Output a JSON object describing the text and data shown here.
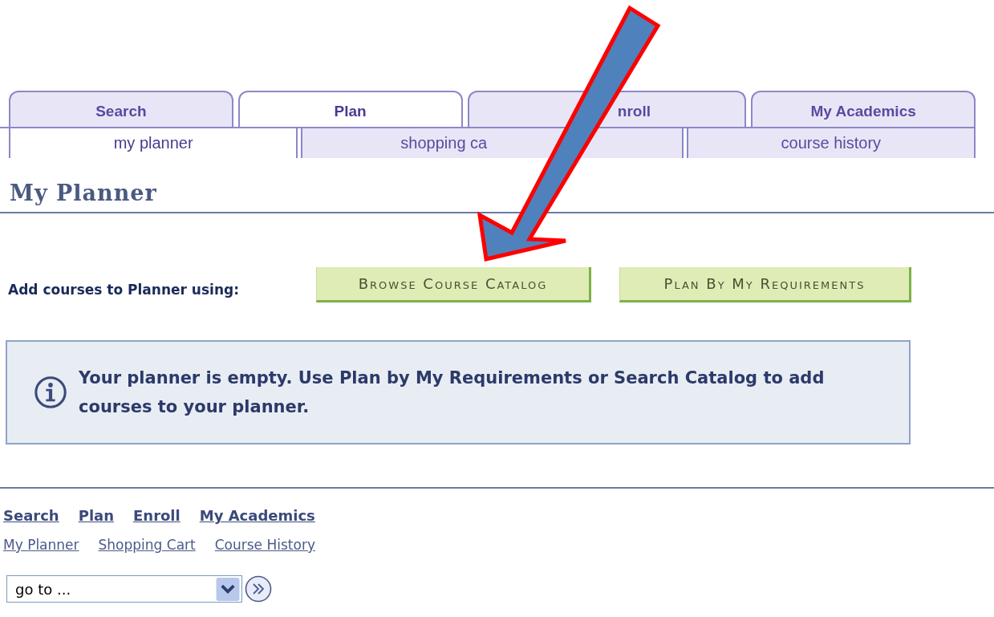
{
  "tabs": [
    {
      "label": "Search",
      "selected": false
    },
    {
      "label": "Plan",
      "selected": true
    },
    {
      "label": "nroll",
      "selected": false
    },
    {
      "label": "My Academics",
      "selected": false
    }
  ],
  "subtabs": [
    {
      "label": "my planner",
      "selected": true
    },
    {
      "label": "shopping ca",
      "selected": false
    },
    {
      "label": "course history",
      "selected": false
    }
  ],
  "heading": "My Planner",
  "add_label": "Add courses to Planner using:",
  "buttons": [
    "Browse Course Catalog",
    "Plan By My Requirements"
  ],
  "message": "Your planner is empty.  Use Plan by My Requirements or Search Catalog to add courses to your planner.",
  "main_links": [
    "Search",
    "Plan",
    "Enroll",
    "My Academics"
  ],
  "sub_links": [
    "My Planner",
    "Shopping Cart",
    "Course History"
  ],
  "goto": {
    "value": "go to ..."
  }
}
